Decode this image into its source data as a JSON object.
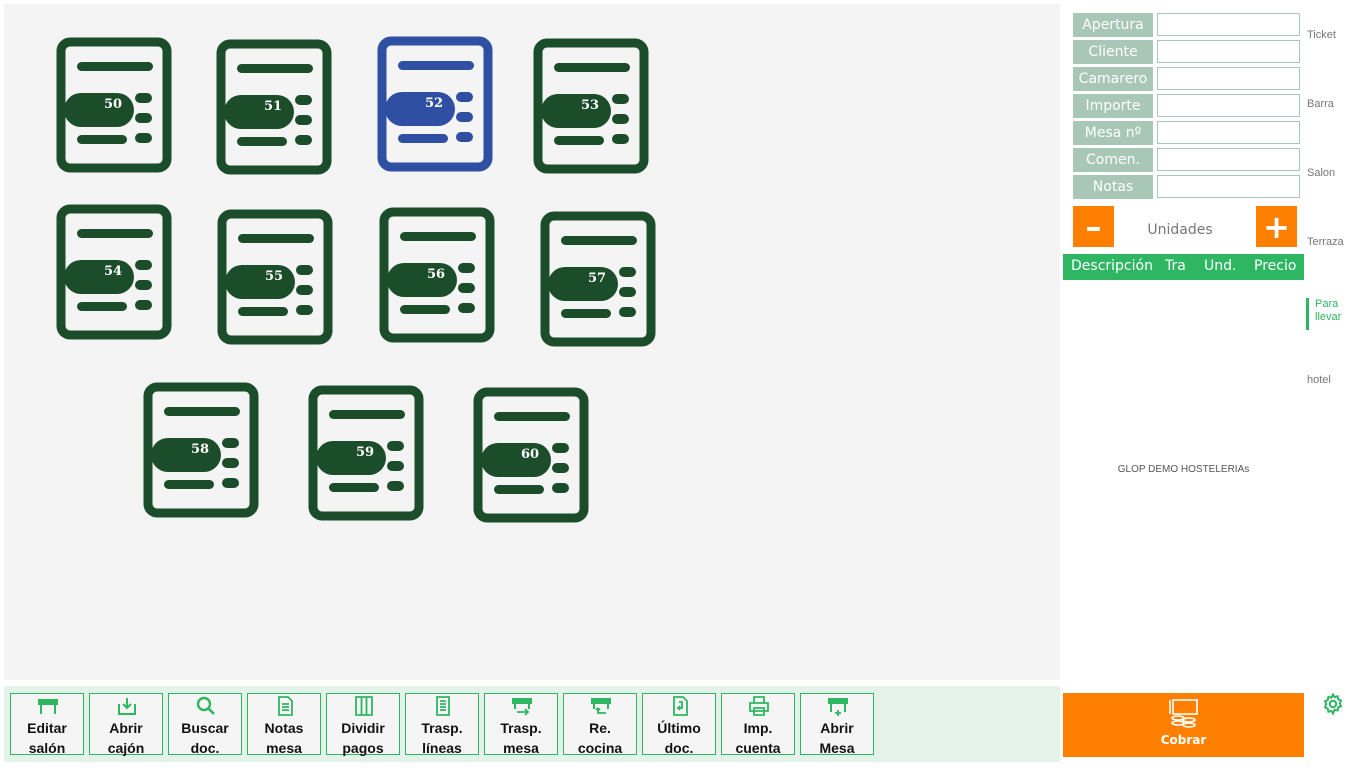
{
  "colors": {
    "table_free": "#1c4d2a",
    "table_selected": "#2f4fa3",
    "accent_green": "#2fb663",
    "accent_orange": "#ff8000",
    "label_bg": "#a9c7b6"
  },
  "tables": [
    {
      "number": "50",
      "selected": false
    },
    {
      "number": "51",
      "selected": false
    },
    {
      "number": "52",
      "selected": true
    },
    {
      "number": "53",
      "selected": false
    },
    {
      "number": "54",
      "selected": false
    },
    {
      "number": "55",
      "selected": false
    },
    {
      "number": "56",
      "selected": false
    },
    {
      "number": "57",
      "selected": false
    },
    {
      "number": "58",
      "selected": false
    },
    {
      "number": "59",
      "selected": false
    },
    {
      "number": "60",
      "selected": false
    }
  ],
  "info": {
    "fields": [
      {
        "label": "Apertura",
        "value": ""
      },
      {
        "label": "Cliente",
        "value": ""
      },
      {
        "label": "Camarero",
        "value": ""
      },
      {
        "label": "Importe",
        "value": ""
      },
      {
        "label": "Mesa nº",
        "value": ""
      },
      {
        "label": "Comen.",
        "value": ""
      },
      {
        "label": "Notas",
        "value": ""
      }
    ]
  },
  "categories": {
    "ticket": "Ticket",
    "barra": "Barra",
    "salon": "Salon",
    "terraza": "Terraza",
    "para_llevar": "Para llevar",
    "hotel": "hotel",
    "active": "Para llevar"
  },
  "units": {
    "minus": "–",
    "label": "Unidades",
    "plus": "+"
  },
  "grid": {
    "columns": [
      "Descripción",
      "Tra",
      "Und.",
      "Precio"
    ],
    "company": "GLOP DEMO HOSTELERIAs"
  },
  "toolbar": [
    {
      "label": "Editar\nsalón",
      "icon": "table-icon"
    },
    {
      "label": "Abrir\ncajón",
      "icon": "drawer-download-icon"
    },
    {
      "label": "Buscar\ndoc.",
      "icon": "search-icon"
    },
    {
      "label": "Notas\nmesa",
      "icon": "document-icon"
    },
    {
      "label": "Dividir\npagos",
      "icon": "columns-icon"
    },
    {
      "label": "Trasp.\nlíneas",
      "icon": "list-document-icon"
    },
    {
      "label": "Trasp.\nmesa",
      "icon": "table-move-icon"
    },
    {
      "label": "Re.\ncocina",
      "icon": "table-undo-icon"
    },
    {
      "label": "Último\ndoc.",
      "icon": "document-return-icon"
    },
    {
      "label": "Imp.\ncuenta",
      "icon": "printer-icon"
    },
    {
      "label": "Abrir\nMesa",
      "icon": "table-add-icon"
    }
  ],
  "cobrar": {
    "label": "Cobrar",
    "icon": "cash-register-icon"
  },
  "settings_icon": "gear-icon"
}
